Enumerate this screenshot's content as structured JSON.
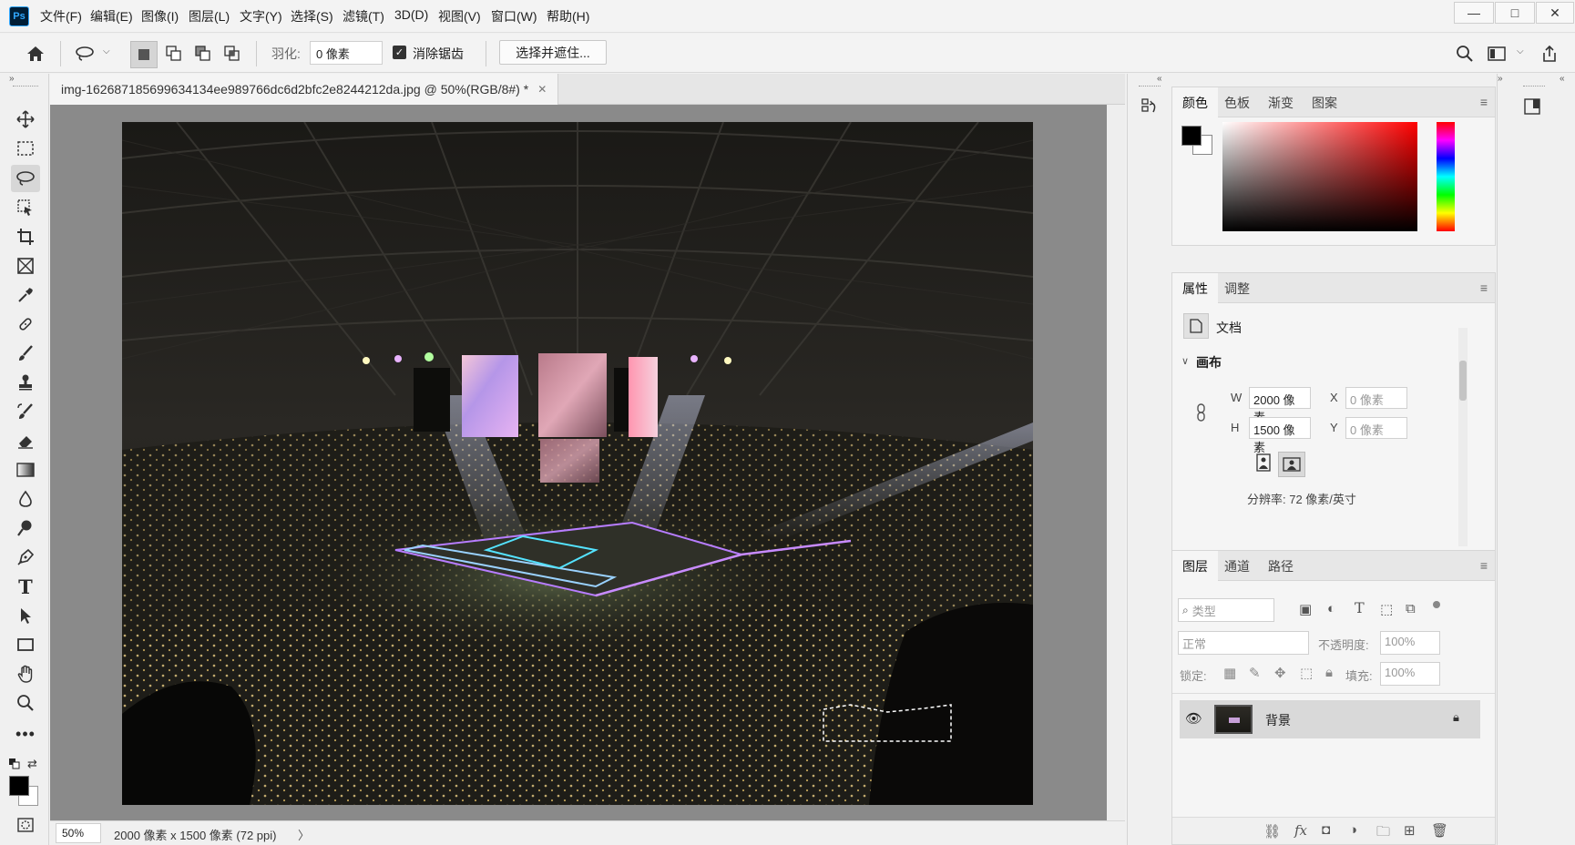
{
  "app": {
    "logo": "Ps"
  },
  "menu": [
    "文件(F)",
    "编辑(E)",
    "图像(I)",
    "图层(L)",
    "文字(Y)",
    "选择(S)",
    "滤镜(T)",
    "3D(D)",
    "视图(V)",
    "窗口(W)",
    "帮助(H)"
  ],
  "window_controls": {
    "minimize": "—",
    "maximize": "□",
    "close": "✕"
  },
  "options": {
    "feather_label": "羽化:",
    "feather_value": "0 像素",
    "antialias_label": "消除锯齿",
    "antialias_checked": true,
    "select_mask_button": "选择并遮住..."
  },
  "document": {
    "tab_title": "img-1626871856996341​34ee989766dc6d2bfc2e8244212da.jpg @ 50%(RGB/8#) *",
    "zoom": "50%",
    "status_info": "2000 像素 x 1500 像素 (72 ppi)",
    "status_arrow": "〉"
  },
  "color_panel": {
    "tabs": [
      "颜色",
      "色板",
      "渐变",
      "图案"
    ],
    "active_tab": "颜色",
    "foreground": "#000000",
    "background": "#ffffff",
    "hue_color": "#ff0000"
  },
  "properties_panel": {
    "tabs": [
      "属性",
      "调整"
    ],
    "doc_label": "文档",
    "section": "画布",
    "w_label": "W",
    "w_value": "2000 像素",
    "h_label": "H",
    "h_value": "1500 像素",
    "x_label": "X",
    "x_value": "0 像素",
    "y_label": "Y",
    "y_value": "0 像素",
    "resolution": "分辨率: 72 像素/英寸"
  },
  "layers_panel": {
    "tabs": [
      "图层",
      "通道",
      "路径"
    ],
    "filter_placeholder": "类型",
    "blend_mode": "正常",
    "opacity_label": "不透明度:",
    "opacity_value": "100%",
    "lock_label": "锁定:",
    "fill_label": "填充:",
    "fill_value": "100%",
    "layers": [
      {
        "name": "背景",
        "visible": true,
        "locked": true
      }
    ]
  }
}
